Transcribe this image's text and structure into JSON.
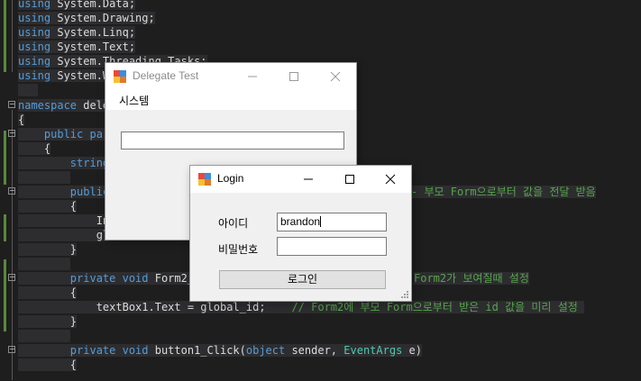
{
  "editor": {
    "lines": {
      "l1": {
        "kw": "using",
        "rest": " System.Data;"
      },
      "l2": {
        "kw": "using",
        "rest": " System.Drawing;"
      },
      "l3": {
        "kw": "using",
        "rest": " System.Linq;"
      },
      "l4": {
        "kw": "using",
        "rest": " System.Text;"
      },
      "l5": {
        "kw": "using",
        "rest": " System.Threading.Tasks;"
      },
      "l6": {
        "kw": "using",
        "rest": " System.W"
      },
      "l7": {
        "kw": "namespace",
        "rest": " dele"
      },
      "l8": {
        "rest": "{"
      },
      "l9": {
        "kw": "public",
        "kw2": " par"
      },
      "l10": {
        "rest": "{"
      },
      "l11": {
        "kw": "string"
      },
      "l12": {
        "kw": "public",
        "cm": "- 부모 Form으로부터 값을 전달 받음"
      },
      "l13": {
        "rest": "{"
      },
      "l14": {
        "rest": "In"
      },
      "l15": {
        "rest": "gl"
      },
      "l16": {
        "rest": "}"
      },
      "l17": {
        "kw": "private",
        "kw2": " void",
        "rest": " Form2_",
        "cm": "Form2가 보여질때 설정"
      },
      "l18": {
        "rest": "{"
      },
      "l19": {
        "rest": "textBox1.Text = global_id;",
        "cm": "// Form2에 부모 Form으로부터 받은 id 값을 미리 설정"
      },
      "l20": {
        "rest": "}"
      },
      "l21": {
        "kw": "private",
        "kw2": " void",
        "rest": " button1_Click(",
        "kw3": "object",
        "rest2": " sender, ",
        "ty": "EventArgs",
        "rest3": " e)"
      },
      "l22": {
        "rest": "{"
      }
    }
  },
  "delegate_window": {
    "title": "Delegate Test",
    "menu": "시스템",
    "textbox_value": ""
  },
  "login_window": {
    "title": "Login",
    "id_label": "아이디",
    "id_value": "brandon",
    "pw_label": "비밀번호",
    "pw_value": "",
    "login_button": "로그인"
  },
  "colors": {
    "keyword": "#569cd6",
    "type": "#4ec9b0",
    "comment": "#57a64a",
    "editor_bg": "#1e1e1e"
  }
}
